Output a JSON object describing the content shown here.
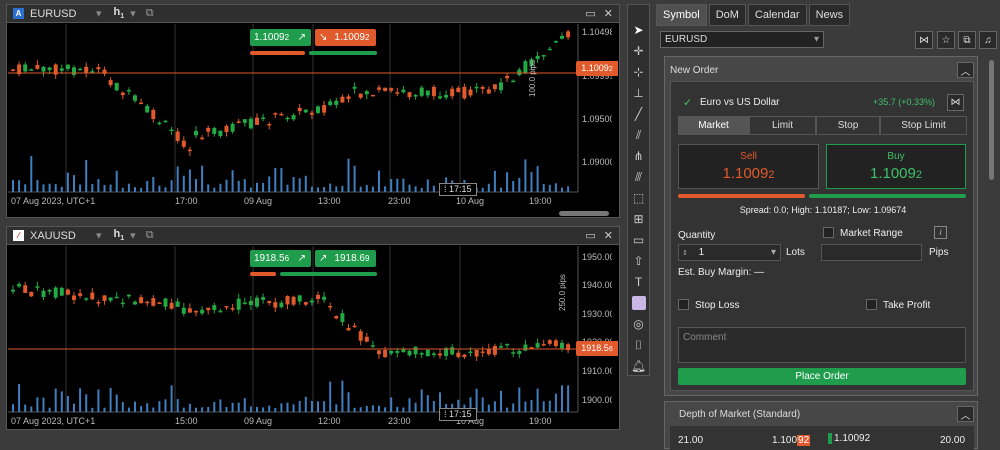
{
  "chart1": {
    "symbol": "EURUSD",
    "timeframe": "h",
    "timeframe_sub": "1",
    "sell_price": "1.1009",
    "sell_price_last": "2",
    "buy_price": "1.1009",
    "buy_price_last": "2",
    "current_tag": "1.1009",
    "current_tag_last": "2",
    "range_label": "100.0 pips",
    "crosshair_time": "17:15",
    "price_ticks": [
      "1.1049",
      "1.0999",
      "1.0950",
      "1.0900"
    ],
    "price_ticks_last": [
      "8",
      "9",
      "0",
      "0"
    ],
    "time_ticks": [
      "07 Aug 2023, UTC+1",
      "17:00",
      "09 Aug",
      "13:00",
      "23:00",
      "10 Aug",
      "19:00"
    ]
  },
  "chart2": {
    "symbol": "XAUUSD",
    "timeframe": "h",
    "timeframe_sub": "1",
    "sell_price": "1918.5",
    "sell_price_last": "6",
    "buy_price": "1918.6",
    "buy_price_last": "9",
    "current_tag": "1918.5",
    "current_tag_last": "6",
    "range_label": "250.0 pips",
    "crosshair_time": "17:15",
    "price_ticks": [
      "1950.0",
      "1940.0",
      "1930.0",
      "1920.0",
      "1910.0",
      "1900.0"
    ],
    "price_ticks_last": [
      "0",
      "0",
      "0",
      "0",
      "0",
      "0"
    ],
    "time_ticks": [
      "07 Aug 2023, UTC+1",
      "15:00",
      "09 Aug",
      "12:00",
      "23:00",
      "10 Aug",
      "19:00"
    ]
  },
  "tabs": [
    "Symbol",
    "DoM",
    "Calendar",
    "News"
  ],
  "symbol_select": "EURUSD",
  "new_order": {
    "title": "New Order",
    "symbol_name": "Euro vs US Dollar",
    "change": "+35.7 (+0.33%)",
    "order_types": [
      "Market",
      "Limit",
      "Stop",
      "Stop Limit"
    ],
    "sell_label": "Sell",
    "sell_price": "1.1009",
    "sell_price_last": "2",
    "buy_label": "Buy",
    "buy_price": "1.1009",
    "buy_price_last": "2",
    "spread_line": "Spread: 0.0; High: 1.10187; Low: 1.09674",
    "quantity_label": "Quantity",
    "quantity_value": "1",
    "lots_label": "Lots",
    "market_range_label": "Market Range",
    "pips_label": "Pips",
    "margin_label": "Est. Buy Margin: —",
    "stop_loss_label": "Stop Loss",
    "take_profit_label": "Take Profit",
    "comment_placeholder": "Comment",
    "place_order_label": "Place Order"
  },
  "dom": {
    "title": "Depth of Market (Standard)",
    "row": {
      "sell_volume": "21.00",
      "sell_price": "1.100",
      "sell_price_last": "92",
      "buy_price": "1.10092",
      "buy_volume": "20.00"
    }
  },
  "colors": {
    "sell": "#e05a2b",
    "buy": "#1f9d4c",
    "bull_candle": "#22aa44",
    "bear_candle": "#e05a2b",
    "volume": "#3f7fc0"
  }
}
